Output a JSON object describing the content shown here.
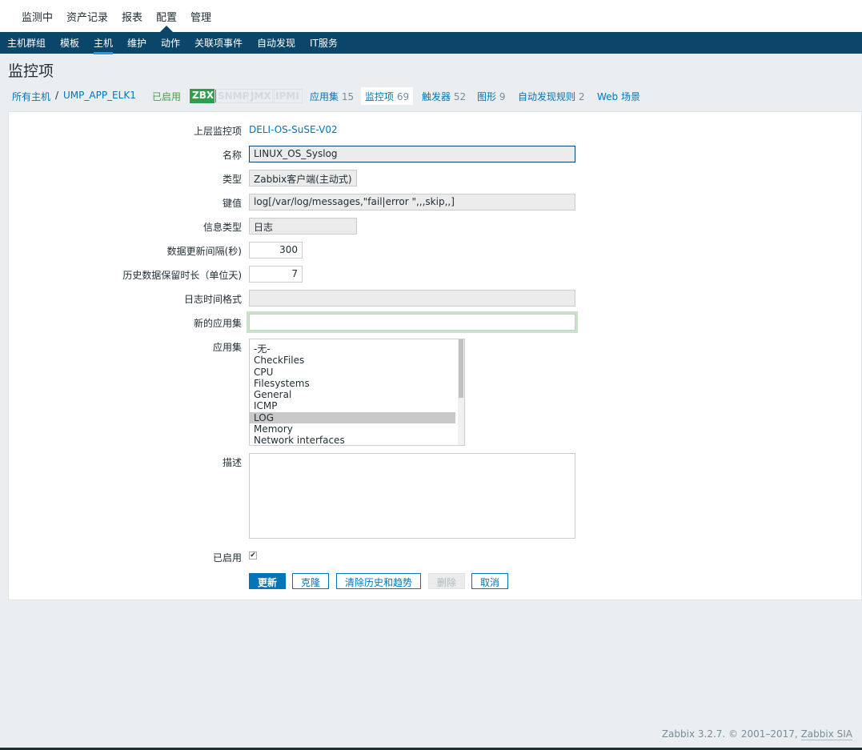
{
  "top_menu": [
    "监测中",
    "资产记录",
    "报表",
    "配置",
    "管理"
  ],
  "sub_menu": [
    "主机群组",
    "模板",
    "主机",
    "维护",
    "动作",
    "关联项事件",
    "自动发现",
    "IT服务"
  ],
  "page_title": "监控项",
  "host_nav": {
    "all_hosts": "所有主机",
    "sep": "/",
    "host": "UMP_APP_ELK1",
    "status": "已启用",
    "badges": [
      "ZBX",
      "SNMP",
      "JMX",
      "IPMI"
    ],
    "tabs": [
      {
        "label": "应用集",
        "count": "15"
      },
      {
        "label": "监控项",
        "count": "69"
      },
      {
        "label": "触发器",
        "count": "52"
      },
      {
        "label": "图形",
        "count": "9"
      },
      {
        "label": "自动发现规则",
        "count": "2"
      },
      {
        "label": "Web 场景",
        "count": ""
      }
    ]
  },
  "form": {
    "parent_label": "上层监控项",
    "parent_value": "DELI-OS-SuSE-V02",
    "name_label": "名称",
    "name_value": "LINUX_OS_Syslog",
    "type_label": "类型",
    "type_value": "Zabbix客户端(主动式)",
    "key_label": "键值",
    "key_value": "log[/var/log/messages,\"fail|error \",,,skip,,]",
    "info_label": "信息类型",
    "info_value": "日志",
    "interval_label": "数据更新间隔(秒)",
    "interval_value": "300",
    "history_label": "历史数据保留时长（单位天)",
    "history_value": "7",
    "logfmt_label": "日志时间格式",
    "logfmt_value": "",
    "newapp_label": "新的应用集",
    "newapp_value": "",
    "apps_label": "应用集",
    "apps": [
      "-无-",
      "CheckFiles",
      "CPU",
      "Filesystems",
      "General",
      "ICMP",
      "LOG",
      "Memory",
      "Network interfaces"
    ],
    "apps_selected": "LOG",
    "desc_label": "描述",
    "desc_value": "",
    "enabled_label": "已启用",
    "enabled": true,
    "buttons": {
      "update": "更新",
      "clone": "克隆",
      "clear": "清除历史和趋势",
      "delete": "删除",
      "cancel": "取消"
    }
  },
  "footer": {
    "text": "Zabbix 3.2.7. © 2001–2017, ",
    "link": "Zabbix SIA"
  },
  "colors": {
    "nav": "#0a466a",
    "link": "#0275b8",
    "zbx": "#2f9f4f",
    "enabled": "#429e47"
  }
}
